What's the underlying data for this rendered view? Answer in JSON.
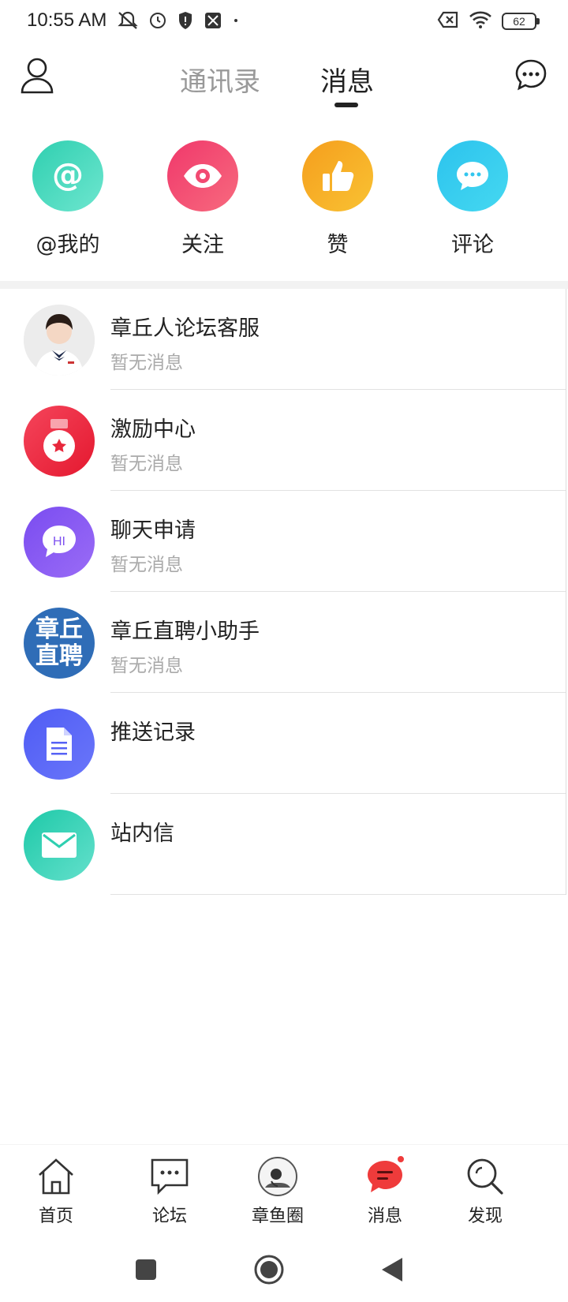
{
  "status_bar": {
    "time": "10:55 AM",
    "battery_level": "62",
    "icons_left": [
      "mute-icon",
      "alarm-icon",
      "shield-icon",
      "sim-icon",
      "dot-icon"
    ],
    "icons_right": [
      "no-sim-icon",
      "wifi-icon",
      "battery-icon"
    ]
  },
  "header": {
    "tabs": [
      {
        "label": "通讯录",
        "active": false
      },
      {
        "label": "消息",
        "active": true
      }
    ],
    "left_icon": "profile-icon",
    "right_icon": "chat-bubble-icon"
  },
  "quick_actions": [
    {
      "label": "@我的",
      "icon": "at-icon",
      "color": "#3fd6b6"
    },
    {
      "label": "关注",
      "icon": "eye-icon",
      "color": "#f5466f"
    },
    {
      "label": "赞",
      "icon": "thumbs-up-icon",
      "color": "#f7a523"
    },
    {
      "label": "评论",
      "icon": "comment-icon",
      "color": "#33c6ee"
    }
  ],
  "messages": [
    {
      "title": "章丘人论坛客服",
      "subtitle": "暂无消息",
      "avatar": "customer-service-avatar"
    },
    {
      "title": "激励中心",
      "subtitle": "暂无消息",
      "avatar": "medal-icon"
    },
    {
      "title": "聊天申请",
      "subtitle": "暂无消息",
      "avatar": "hi-chat-icon"
    },
    {
      "title": "章丘直聘小助手",
      "subtitle": "暂无消息",
      "avatar": "recruit-logo",
      "avatar_text": "章丘直聘"
    },
    {
      "title": "推送记录",
      "subtitle": "",
      "avatar": "document-icon"
    },
    {
      "title": "站内信",
      "subtitle": "",
      "avatar": "envelope-icon"
    }
  ],
  "bottom_nav": [
    {
      "label": "首页",
      "icon": "home-icon"
    },
    {
      "label": "论坛",
      "icon": "forum-icon"
    },
    {
      "label": "章鱼圈",
      "icon": "octopus-circle-icon"
    },
    {
      "label": "消息",
      "icon": "message-icon",
      "active": true,
      "badge": true
    },
    {
      "label": "发现",
      "icon": "discover-icon"
    }
  ],
  "colors": {
    "accent_red": "#ef3b3b",
    "text_primary": "#222222",
    "text_muted": "#aaaaaa",
    "tab_inactive": "#999999"
  }
}
